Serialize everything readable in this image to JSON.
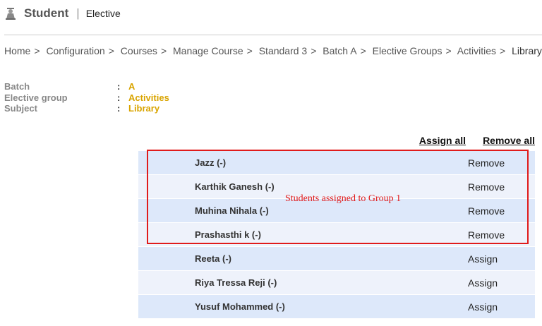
{
  "header": {
    "app_title": "Student",
    "section": "Elective",
    "logo_icon": "student-logo-icon"
  },
  "breadcrumb": [
    "Home",
    "Configuration",
    "Courses",
    "Manage Course",
    "Standard 3",
    "Batch A",
    "Elective Groups",
    "Activities",
    "Library"
  ],
  "info": [
    {
      "label": "Batch",
      "value": "A"
    },
    {
      "label": "Elective group",
      "value": "Activities"
    },
    {
      "label": "Subject",
      "value": "Library"
    }
  ],
  "actions": {
    "assign_all": "Assign all",
    "remove_all": "Remove all"
  },
  "students": [
    {
      "name": "Jazz (-)",
      "action": "Remove"
    },
    {
      "name": "Karthik Ganesh (-)",
      "action": "Remove"
    },
    {
      "name": "Muhina Nihala (-)",
      "action": "Remove"
    },
    {
      "name": "Prashasthi k (-)",
      "action": "Remove"
    },
    {
      "name": "Reeta (-)",
      "action": "Assign"
    },
    {
      "name": "Riya Tressa Reji (-)",
      "action": "Assign"
    },
    {
      "name": "Yusuf Mohammed (-)",
      "action": "Assign"
    }
  ],
  "annotation": "Students assigned to Group 1",
  "colors": {
    "accent": "#d9a400",
    "highlight": "#e01b1b",
    "row_odd": "#dde8fa",
    "row_even": "#eef2fb"
  }
}
